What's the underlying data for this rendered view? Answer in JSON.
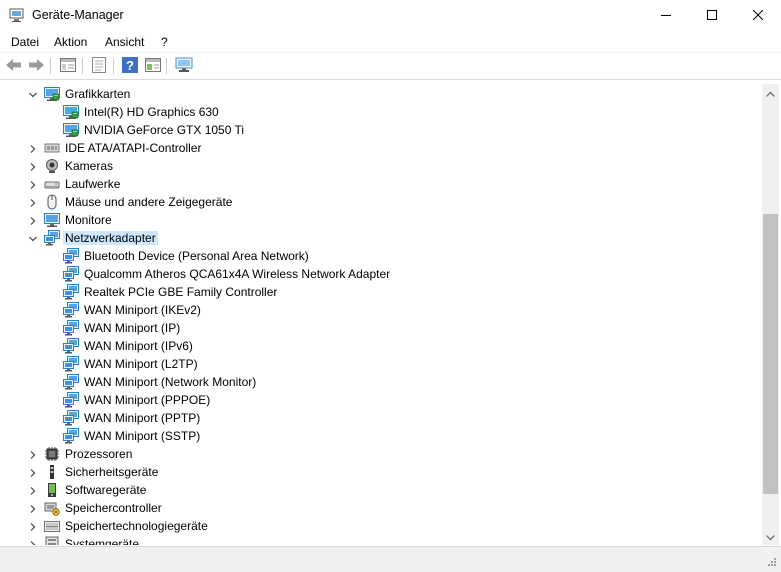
{
  "window": {
    "title": "Geräte-Manager",
    "icons": {
      "app": "device-manager-icon",
      "minimize": "minimize-icon",
      "maximize": "maximize-icon",
      "close": "close-icon"
    }
  },
  "menu": {
    "items": [
      "Datei",
      "Aktion",
      "Ansicht",
      "?"
    ]
  },
  "toolbar": {
    "buttons": [
      "back-arrow-icon",
      "forward-arrow-icon",
      "properties-window-icon",
      "driver-details-icon",
      "help-icon",
      "view-icon",
      "monitor-scan-icon"
    ]
  },
  "tree": {
    "nodes": [
      {
        "label": "Grafikkarten",
        "icon": "display-adapter-icon",
        "expanded": true,
        "children": [
          {
            "label": "Intel(R) HD Graphics 630",
            "icon": "display-adapter-icon"
          },
          {
            "label": "NVIDIA GeForce GTX 1050 Ti",
            "icon": "display-adapter-icon"
          }
        ]
      },
      {
        "label": "IDE ATA/ATAPI-Controller",
        "icon": "ide-controller-icon",
        "expanded": false
      },
      {
        "label": "Kameras",
        "icon": "camera-icon",
        "expanded": false
      },
      {
        "label": "Laufwerke",
        "icon": "disk-drive-icon",
        "expanded": false
      },
      {
        "label": "Mäuse und andere Zeigegeräte",
        "icon": "mouse-icon",
        "expanded": false
      },
      {
        "label": "Monitore",
        "icon": "monitor-icon",
        "expanded": false
      },
      {
        "label": "Netzwerkadapter",
        "icon": "network-adapter-icon",
        "expanded": true,
        "selected": true,
        "children": [
          {
            "label": "Bluetooth Device (Personal Area Network)",
            "icon": "network-adapter-icon"
          },
          {
            "label": "Qualcomm Atheros QCA61x4A Wireless Network Adapter",
            "icon": "network-adapter-icon"
          },
          {
            "label": "Realtek PCIe GBE Family Controller",
            "icon": "network-adapter-icon"
          },
          {
            "label": "WAN Miniport (IKEv2)",
            "icon": "network-adapter-icon"
          },
          {
            "label": "WAN Miniport (IP)",
            "icon": "network-adapter-icon"
          },
          {
            "label": "WAN Miniport (IPv6)",
            "icon": "network-adapter-icon"
          },
          {
            "label": "WAN Miniport (L2TP)",
            "icon": "network-adapter-icon"
          },
          {
            "label": "WAN Miniport (Network Monitor)",
            "icon": "network-adapter-icon"
          },
          {
            "label": "WAN Miniport (PPPOE)",
            "icon": "network-adapter-icon"
          },
          {
            "label": "WAN Miniport (PPTP)",
            "icon": "network-adapter-icon"
          },
          {
            "label": "WAN Miniport (SSTP)",
            "icon": "network-adapter-icon"
          }
        ]
      },
      {
        "label": "Prozessoren",
        "icon": "processor-icon",
        "expanded": false
      },
      {
        "label": "Sicherheitsgeräte",
        "icon": "security-device-icon",
        "expanded": false
      },
      {
        "label": "Softwaregeräte",
        "icon": "software-device-icon",
        "expanded": false
      },
      {
        "label": "Speichercontroller",
        "icon": "storage-controller-icon",
        "expanded": false
      },
      {
        "label": "Speichertechnologiegeräte",
        "icon": "storage-technology-icon",
        "expanded": false
      },
      {
        "label": "Systemgeräte",
        "icon": "system-device-icon",
        "expanded": false
      }
    ]
  },
  "colors": {
    "selection": "#cce8ff",
    "network_blue": "#2f8fd8",
    "chevron": "#404040"
  }
}
